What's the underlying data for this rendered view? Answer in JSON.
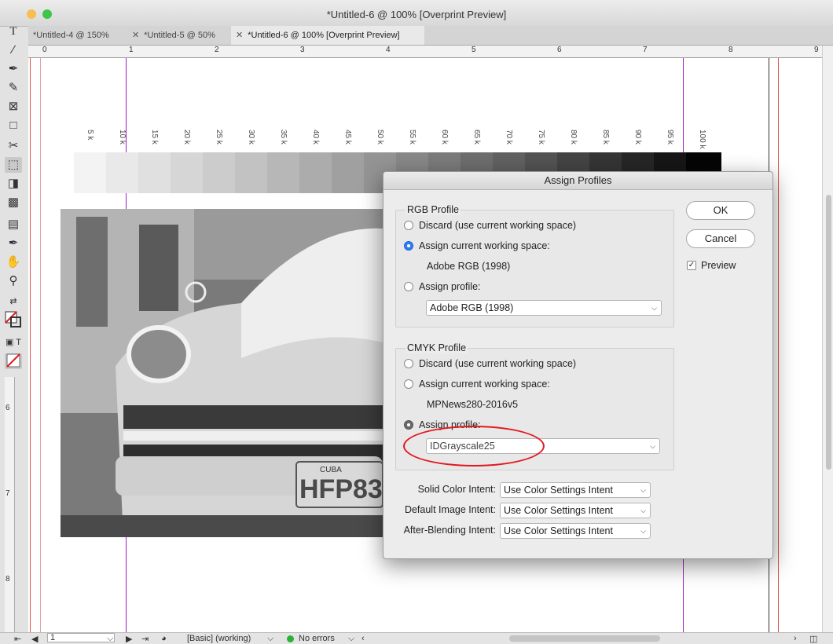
{
  "window": {
    "title": "*Untitled-6 @ 100% [Overprint Preview]"
  },
  "tabs": [
    {
      "label": "*Untitled-4 @ 150%"
    },
    {
      "label": "*Untitled-5 @ 50%"
    },
    {
      "label": "*Untitled-6 @ 100% [Overprint Preview]"
    }
  ],
  "ruler": {
    "h": [
      "0",
      "1",
      "2",
      "3",
      "4",
      "5",
      "6",
      "7",
      "8",
      "9"
    ],
    "v": [
      "6",
      "7",
      "8"
    ]
  },
  "grayscale_steps": [
    "5 k",
    "10 k",
    "15 k",
    "20 k",
    "25 k",
    "30 k",
    "35 k",
    "40 k",
    "45 k",
    "50 k",
    "55 k",
    "60 k",
    "65 k",
    "70 k",
    "75 k",
    "80 k",
    "85 k",
    "90 k",
    "95 k",
    "100 k"
  ],
  "photo": {
    "plate_text": "HFP83",
    "plate_top": "CUBA"
  },
  "dialog": {
    "title": "Assign Profiles",
    "rgb": {
      "label": "RGB Profile",
      "opt_discard": "Discard (use current working space)",
      "opt_assign_current": "Assign current working space:",
      "current_space": "Adobe RGB (1998)",
      "opt_assign_profile": "Assign profile:",
      "profile_value": "Adobe RGB (1998)"
    },
    "cmyk": {
      "label": "CMYK Profile",
      "opt_discard": "Discard (use current working space)",
      "opt_assign_current": "Assign current working space:",
      "current_space": "MPNews280-2016v5",
      "opt_assign_profile": "Assign profile:",
      "profile_value": "IDGrayscale25"
    },
    "intents": {
      "solid_label": "Solid Color Intent:",
      "solid_value": "Use Color Settings Intent",
      "image_label": "Default Image Intent:",
      "image_value": "Use Color Settings Intent",
      "blend_label": "After-Blending Intent:",
      "blend_value": "Use Color Settings Intent"
    },
    "ok_label": "OK",
    "cancel_label": "Cancel",
    "preview_label": "Preview"
  },
  "status": {
    "page": "1",
    "style": "[Basic] (working)",
    "errors": "No errors"
  },
  "colors": {
    "accent": "#2f7df6",
    "annotation": "#e3181f",
    "guide": "#a020c0",
    "bleed": "#e05050",
    "status_ok": "#27b33a"
  }
}
